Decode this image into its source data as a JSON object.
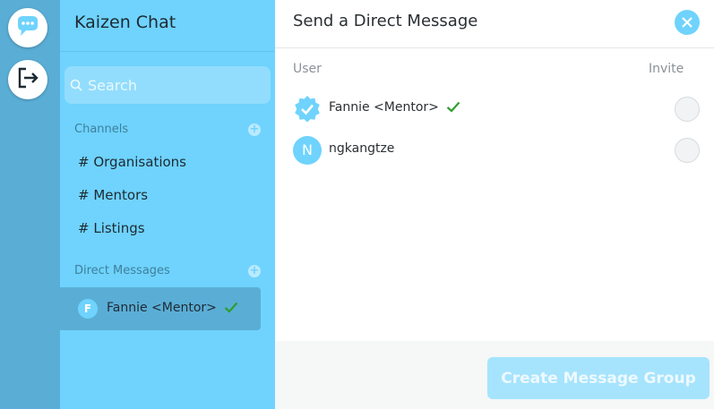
{
  "app": {
    "title": "Kaizen Chat"
  },
  "search": {
    "placeholder": "Search"
  },
  "sidebar": {
    "channels_label": "Channels",
    "channels": [
      "# Organisations",
      "# Mentors",
      "# Listings"
    ],
    "dm_label": "Direct Messages",
    "dm_items": [
      {
        "avatar": "F",
        "name": "Fannie <Mentor>"
      }
    ]
  },
  "dialog": {
    "title": "Send a Direct Message",
    "col_user": "User",
    "col_invite": "Invite",
    "users": [
      {
        "name": "Fannie <Mentor>",
        "verified": true
      },
      {
        "avatar": "N",
        "name": "ngkangtze",
        "verified": false
      }
    ],
    "create_button": "Create Message Group"
  },
  "colors": {
    "accent": "#6fd3fd",
    "rail": "#5aaed6",
    "check": "#2e9e2e"
  },
  "icons": [
    "chat-bubble-icon",
    "logout-icon",
    "search-icon",
    "plus-icon",
    "close-icon",
    "check-icon",
    "verified-badge-icon"
  ]
}
